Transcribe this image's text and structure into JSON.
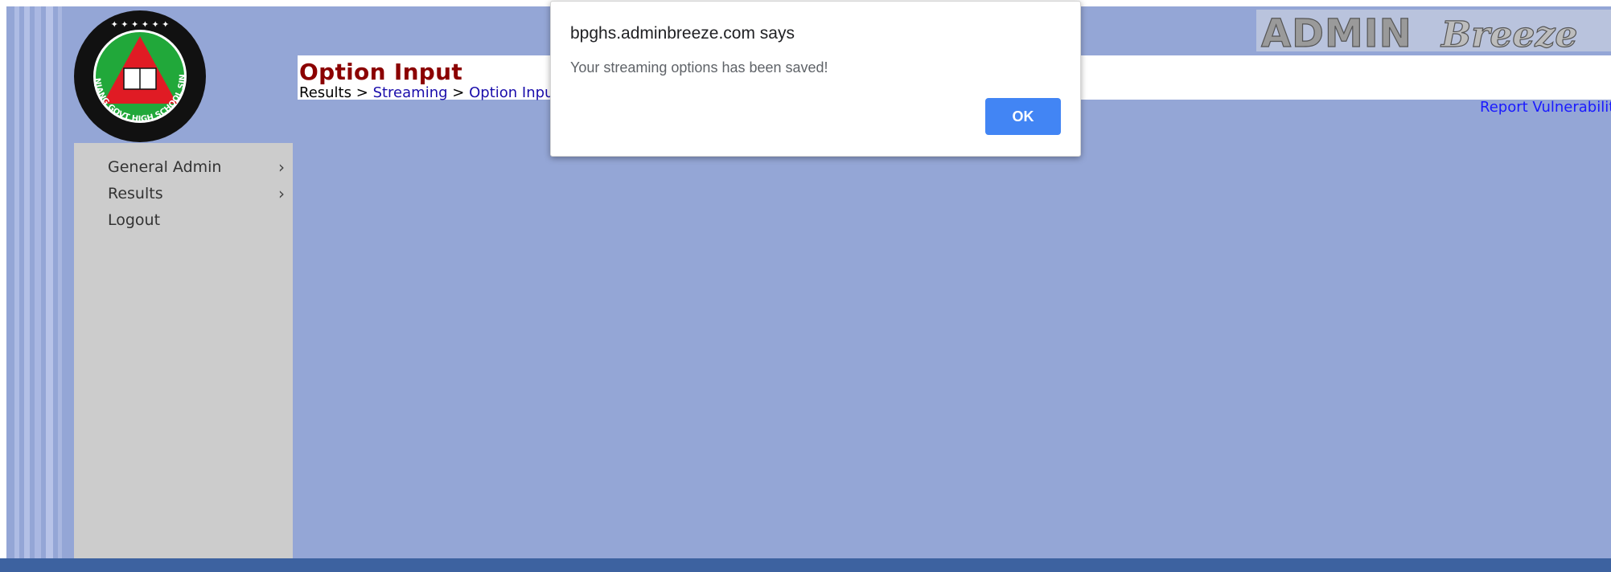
{
  "header": {
    "title": "Option Input",
    "breadcrumb": {
      "root": "Results",
      "separator": ">",
      "link1": "Streaming",
      "link2": "Option Input"
    },
    "report_link": "Report Vulnerability",
    "brand_logo_text": "ADMINBreeze"
  },
  "school_logo": {
    "text": "BUKIT PANJANG GOVT HIGH SCHOOL SINGAPORE",
    "icon": "school-crest-icon"
  },
  "sidebar": {
    "items": [
      {
        "label": "General Admin",
        "has_submenu": true
      },
      {
        "label": "Results",
        "has_submenu": true
      },
      {
        "label": "Logout",
        "has_submenu": false
      }
    ]
  },
  "dialog": {
    "origin": "bpghs.adminbreeze.com says",
    "message": "Your streaming options has been saved!",
    "ok_label": "OK"
  },
  "colors": {
    "page_background": "#94a6d6",
    "title": "#8b0000",
    "link": "#1a0dab",
    "sidebar": "#cccccc",
    "dialog_button": "#4285f4",
    "bottom_bar": "#3d62a0"
  }
}
